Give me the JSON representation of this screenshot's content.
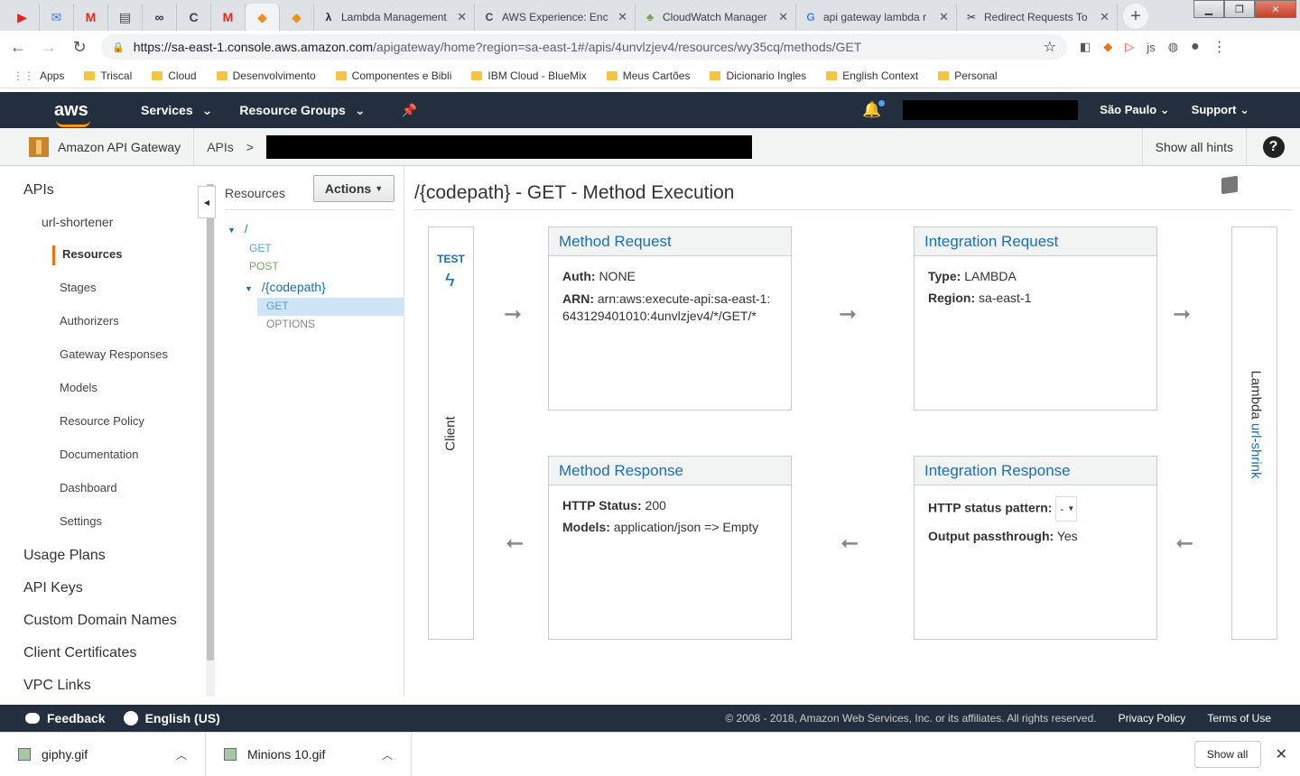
{
  "browser": {
    "pinned_tabs": [
      {
        "icon": "youtube-icon",
        "glyph": "▶",
        "color": "#e62117"
      },
      {
        "icon": "mail-icon",
        "glyph": "✉",
        "color": "#3b7ddd"
      },
      {
        "icon": "gmail-icon",
        "glyph": "M",
        "color": "#d93025"
      },
      {
        "icon": "board-icon",
        "glyph": "▤",
        "color": "#444"
      },
      {
        "icon": "glasses-icon",
        "glyph": "∞",
        "color": "#333"
      },
      {
        "icon": "c-icon",
        "glyph": "C",
        "color": "#444"
      },
      {
        "icon": "gmail-icon",
        "glyph": "M",
        "color": "#d93025"
      },
      {
        "icon": "aws-cube-icon",
        "glyph": "◆",
        "color": "#f0911f",
        "active": true
      },
      {
        "icon": "aws-cube-icon",
        "glyph": "◆",
        "color": "#f0911f"
      }
    ],
    "tabs": [
      {
        "title": "Lambda Management",
        "icon": "lambda-icon",
        "glyph": "λ",
        "color": "#222"
      },
      {
        "title": "AWS Experience: Enc",
        "icon": "c-icon",
        "glyph": "C",
        "color": "#444"
      },
      {
        "title": "CloudWatch Manager",
        "icon": "cloudwatch-icon",
        "glyph": "♣",
        "color": "#759c3e"
      },
      {
        "title": "api gateway lambda r",
        "icon": "google-icon",
        "glyph": "G",
        "color": "#4285f4"
      },
      {
        "title": "Redirect Requests To",
        "icon": "tools-icon",
        "glyph": "✂",
        "color": "#333"
      }
    ],
    "url_host": "https://sa-east-1.console.aws.amazon.com",
    "url_path": "/apigateway/home?region=sa-east-1#/apis/4unvlzjev4/resources/wy35cq/methods/GET",
    "bookmarks": [
      "Apps",
      "Triscal",
      "Cloud",
      "Desenvolvimento",
      "Componentes e Bibli",
      "IBM Cloud - BlueMix",
      "Meus Cartões",
      "Dicionario Ingles",
      "English Context",
      "Personal"
    ]
  },
  "aws_header": {
    "logo": "aws",
    "services": "Services",
    "resource_groups": "Resource Groups",
    "region": "São Paulo",
    "support": "Support"
  },
  "subheader": {
    "service_name": "Amazon API Gateway",
    "crumb_apis": "APIs",
    "crumb_sep": ">",
    "show_hints": "Show all hints",
    "help": "?"
  },
  "leftnav": {
    "apis": "APIs",
    "api_name": "url-shortener",
    "items": [
      "Resources",
      "Stages",
      "Authorizers",
      "Gateway Responses",
      "Models",
      "Resource Policy",
      "Documentation",
      "Dashboard",
      "Settings"
    ],
    "top_items": [
      "Usage Plans",
      "API Keys",
      "Custom Domain Names",
      "Client Certificates",
      "VPC Links"
    ]
  },
  "resources": {
    "title": "Resources",
    "actions": "Actions",
    "root": "/",
    "root_methods": [
      "GET",
      "POST"
    ],
    "child": "/{codepath}",
    "child_methods": [
      "GET",
      "OPTIONS"
    ]
  },
  "main": {
    "title": "/{codepath} - GET - Method Execution",
    "test": "TEST",
    "client": "Client",
    "lambda_prefix": "Lambda ",
    "lambda_fn": "url-shrink",
    "method_request": {
      "title": "Method Request",
      "auth_label": "Auth:",
      "auth_value": "NONE",
      "arn_label": "ARN:",
      "arn_value": "arn:aws:execute-api:sa-east-1:643129401010:4unvlzjev4/*/GET/*"
    },
    "integration_request": {
      "title": "Integration Request",
      "type_label": "Type:",
      "type_value": "LAMBDA",
      "region_label": "Region:",
      "region_value": "sa-east-1"
    },
    "method_response": {
      "title": "Method Response",
      "status_label": "HTTP Status:",
      "status_value": "200",
      "models_label": "Models:",
      "models_value": "application/json => Empty"
    },
    "integration_response": {
      "title": "Integration Response",
      "pattern_label": "HTTP status pattern:",
      "pattern_value": "-",
      "passthrough_label": "Output passthrough:",
      "passthrough_value": "Yes"
    }
  },
  "footer": {
    "feedback": "Feedback",
    "language": "English (US)",
    "copyright": "© 2008 - 2018, Amazon Web Services, Inc. or its affiliates. All rights reserved.",
    "privacy": "Privacy Policy",
    "terms": "Terms of Use"
  },
  "downloads": {
    "files": [
      "giphy.gif",
      "Minions 10.gif"
    ],
    "show_all": "Show all"
  },
  "colors": {
    "aws_dark": "#232f3e",
    "aws_orange": "#ec7211",
    "link_blue": "#1a6fb5",
    "get_method": "#5a9fd4",
    "post_method": "#6fae54"
  }
}
